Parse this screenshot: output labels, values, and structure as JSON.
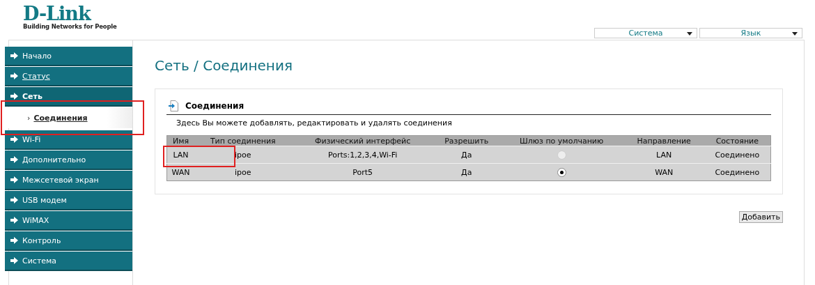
{
  "logo": {
    "brand": "D-Link",
    "tagline": "Building Networks for People"
  },
  "top_menus": [
    {
      "label": "Система"
    },
    {
      "label": "Язык"
    }
  ],
  "sidebar": {
    "items": [
      {
        "label": "Начало",
        "kind": "menu",
        "expanded": false,
        "underlined": false
      },
      {
        "label": "Статус",
        "kind": "menu",
        "expanded": false,
        "underlined": true
      },
      {
        "label": "Сеть",
        "kind": "menu",
        "expanded": true,
        "underlined": false
      },
      {
        "label": "Соединения",
        "kind": "submenu",
        "bullet": "›",
        "selected": true,
        "underlined": true
      },
      {
        "label": "Wi-Fi",
        "kind": "menu",
        "expanded": false,
        "underlined": false
      },
      {
        "label": "Дополнительно",
        "kind": "menu",
        "expanded": false,
        "underlined": false
      },
      {
        "label": "Межсетевой экран",
        "kind": "menu",
        "expanded": false,
        "underlined": false
      },
      {
        "label": "USB модем",
        "kind": "menu",
        "expanded": false,
        "underlined": false
      },
      {
        "label": "WiMAX",
        "kind": "menu",
        "expanded": false,
        "underlined": false
      },
      {
        "label": "Контроль",
        "kind": "menu",
        "expanded": false,
        "underlined": false
      },
      {
        "label": "Система",
        "kind": "menu",
        "expanded": false,
        "underlined": false
      }
    ]
  },
  "page_title": "Сеть / Соединения",
  "panel": {
    "title": "Соединения",
    "description": "Здесь Вы можете добавлять, редактировать и удалять соединения",
    "table": {
      "columns": [
        "Имя",
        "Тип соединения",
        "Физический интерфейс",
        "Разрешить",
        "Шлюз по умолчанию",
        "Направление",
        "Состояние"
      ],
      "rows": [
        {
          "name": "LAN",
          "type": "ipoe",
          "interface": "Ports:1,2,3,4,Wi-Fi",
          "allow": "Да",
          "gateway": {
            "selected": false,
            "disabled": true
          },
          "direction": "LAN",
          "state": "Соединено"
        },
        {
          "name": "WAN",
          "type": "ipoe",
          "interface": "Port5",
          "allow": "Да",
          "gateway": {
            "selected": true,
            "disabled": false
          },
          "direction": "WAN",
          "state": "Соединено"
        }
      ]
    }
  },
  "add_button": "Добавить"
}
